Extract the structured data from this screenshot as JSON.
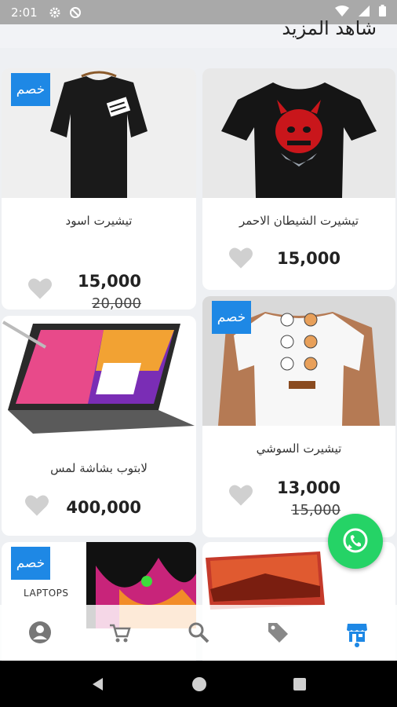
{
  "status_bar": {
    "time": "2:01"
  },
  "header": {
    "title": "شاهد المزيد"
  },
  "products": [
    {
      "name": "تيشيرت الشيطان الاحمر",
      "price": "15,000",
      "old_price": "",
      "discount": false
    },
    {
      "name": "تيشيرت اسود",
      "price": "15,000",
      "old_price": "20,000",
      "discount": true,
      "badge": "خصم"
    },
    {
      "name": "تيشيرت السوشي",
      "price": "13,000",
      "old_price": "15,000",
      "discount": true,
      "badge": "خصم"
    },
    {
      "name": "لابتوب بشاشة لمس",
      "price": "400,000",
      "old_price": "",
      "discount": false
    },
    {
      "name": "",
      "price": "",
      "old_price": "",
      "discount": false
    },
    {
      "name": "",
      "price": "",
      "old_price": "",
      "discount": true,
      "badge": "خصم",
      "label": "LAPTOPS"
    }
  ],
  "bottom_nav": [
    "profile-icon",
    "cart-icon",
    "search-icon",
    "tag-icon",
    "store-icon"
  ],
  "colors": {
    "accent": "#1e88e5",
    "whatsapp": "#25d366",
    "status_bar": "#a9a9a9"
  }
}
